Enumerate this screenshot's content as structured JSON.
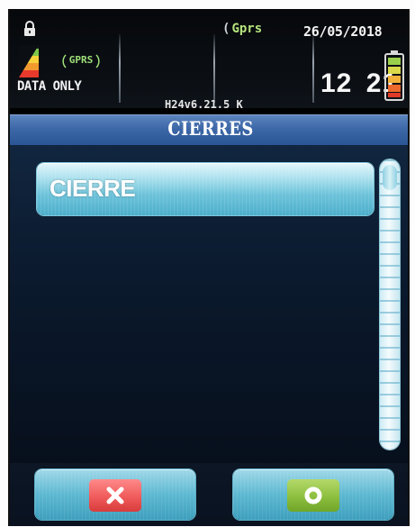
{
  "status_bar": {
    "data_mode": "DATA ONLY",
    "gprs_badge": "GPRS",
    "network": "Gprs",
    "date": "26/05/2018",
    "time": "12 21",
    "firmware": "H24v6.21.5 K",
    "icons": [
      "lock-icon",
      "signal-icon",
      "battery-icon"
    ]
  },
  "header": {
    "title": "CIERRES"
  },
  "list": {
    "items": [
      {
        "label": "CIERRE"
      }
    ]
  },
  "actions": {
    "cancel_icon": "x-icon",
    "confirm_icon": "circle-icon"
  },
  "colors": {
    "title_bar": "#3d68a8",
    "list_item": "#6dc3da",
    "cancel": "#f05b5b",
    "confirm": "#8dbf3f",
    "network_text": "#b5e37d"
  }
}
